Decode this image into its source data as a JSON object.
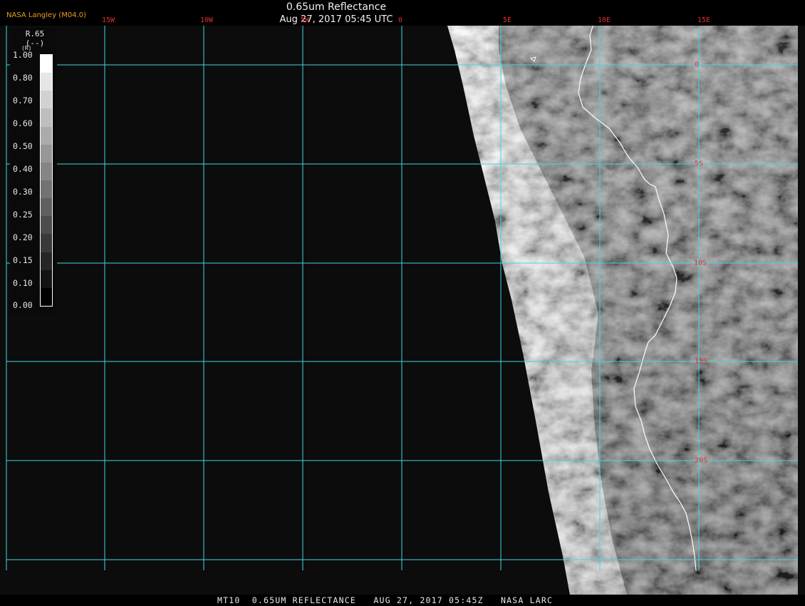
{
  "header": {
    "org_label": "NASA Langley (M04.0)",
    "title": "0.65um Reflectance",
    "subtitle": "Aug 27, 2017 05:45 UTC"
  },
  "map": {
    "longitude_labels": [
      "15W",
      "10W",
      "5W",
      "0",
      "5E",
      "10E",
      "15E"
    ],
    "latitude_labels": [
      "0",
      "5S",
      "10S",
      "15S",
      "20S"
    ],
    "grid_color": "#3fd8e0",
    "label_color": "#e03030",
    "coastline_color": "#ffffff",
    "ocean_color": "#0c0c0c"
  },
  "legend": {
    "title_line1": "R.65",
    "title_line2": "(--)",
    "unit_hint": "(R)",
    "ticks": [
      "1.00",
      "0.80",
      "0.70",
      "0.60",
      "0.50",
      "0.40",
      "0.30",
      "0.25",
      "0.20",
      "0.15",
      "0.10",
      "0.00"
    ],
    "swatch_colors": [
      "#ffffff",
      "#e6e6e6",
      "#d2d2d2",
      "#bebebe",
      "#ababab",
      "#979797",
      "#858585",
      "#727272",
      "#5f5f5f",
      "#4c4c4c",
      "#393939",
      "#262626",
      "#131313",
      "#000000"
    ]
  },
  "footer": {
    "text": "MT10  0.65UM REFLECTANCE   AUG 27, 2017 05:45Z   NASA LARC"
  }
}
